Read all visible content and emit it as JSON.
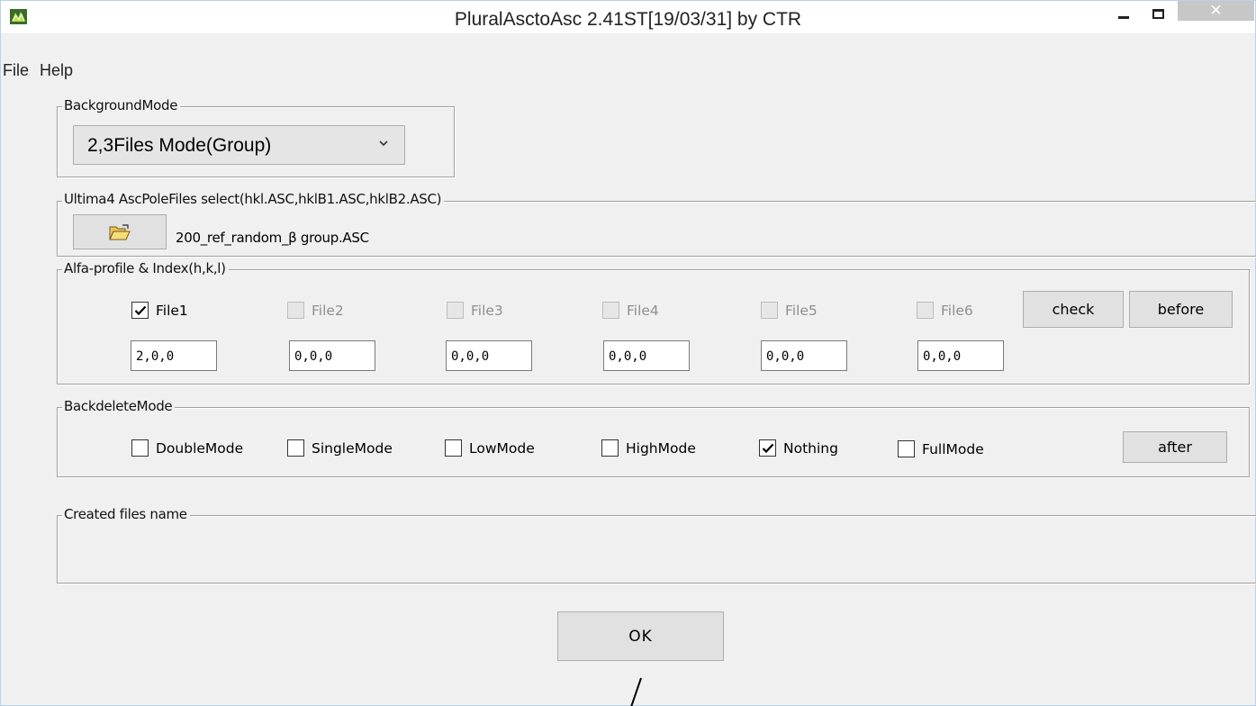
{
  "window": {
    "title": "PluralAsctoAsc 2.41ST[19/03/31] by CTR",
    "close_symbol": "✕",
    "icons": [
      "app-icon",
      "minimize-icon",
      "maximize-icon",
      "close-icon"
    ]
  },
  "menu": {
    "file": "File",
    "help": "Help"
  },
  "background_mode": {
    "legend": "BackgroundMode",
    "selected": "2,3Files Mode(Group)"
  },
  "pole_files": {
    "legend": "Ultima4 AscPoleFiles select(hkl.ASC,hklB1.ASC,hklB2.ASC)",
    "browse_icon": "folder-open-icon",
    "selected_file": "200_ref_random_β group.ASC"
  },
  "alfa_profile": {
    "legend": "Alfa-profile & Index(h,k,l)",
    "files": [
      {
        "label": "File1",
        "checked": true,
        "enabled": true,
        "index": "2,0,0"
      },
      {
        "label": "File2",
        "checked": false,
        "enabled": false,
        "index": "0,0,0"
      },
      {
        "label": "File3",
        "checked": false,
        "enabled": false,
        "index": "0,0,0"
      },
      {
        "label": "File4",
        "checked": false,
        "enabled": false,
        "index": "0,0,0"
      },
      {
        "label": "File5",
        "checked": false,
        "enabled": false,
        "index": "0,0,0"
      },
      {
        "label": "File6",
        "checked": false,
        "enabled": false,
        "index": "0,0,0"
      }
    ],
    "check_label": "check",
    "before_label": "before"
  },
  "backdelete_mode": {
    "legend": "BackdeleteMode",
    "options": [
      {
        "label": "DoubleMode",
        "checked": false
      },
      {
        "label": "SingleMode",
        "checked": false
      },
      {
        "label": "LowMode",
        "checked": false
      },
      {
        "label": "HighMode",
        "checked": false
      },
      {
        "label": "Nothing",
        "checked": true
      },
      {
        "label": "FullMode",
        "checked": false
      }
    ],
    "after_label": "after"
  },
  "created_files": {
    "legend": "Created files name"
  },
  "ok_label": "OK",
  "colors": {
    "window_bg": "#f0f0f0",
    "title_bg": "#ffffff",
    "close_bg": "#c7c7c7",
    "button_bg": "#e1e1e1"
  }
}
